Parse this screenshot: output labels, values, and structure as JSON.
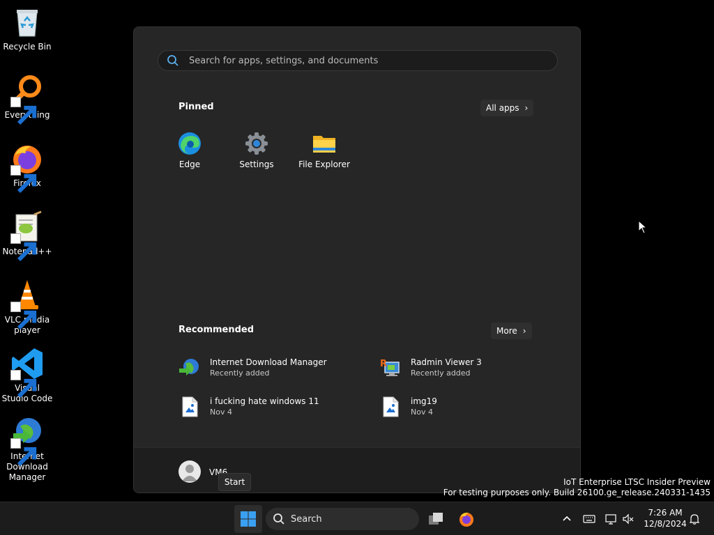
{
  "desktop": {
    "icons": [
      {
        "label": "Recycle Bin"
      },
      {
        "label": "Everything"
      },
      {
        "label": "Firefox"
      },
      {
        "label": "Notepad++"
      },
      {
        "label": "VLC media player"
      },
      {
        "label": "Visual Studio Code"
      },
      {
        "label": "Internet Download Manager"
      }
    ]
  },
  "start_menu": {
    "search_placeholder": "Search for apps, settings, and documents",
    "pinned_title": "Pinned",
    "all_apps_label": "All apps",
    "pinned": [
      {
        "label": "Edge",
        "icon": "edge-icon"
      },
      {
        "label": "Settings",
        "icon": "settings-gear-icon"
      },
      {
        "label": "File Explorer",
        "icon": "folder-icon"
      }
    ],
    "recommended_title": "Recommended",
    "more_label": "More",
    "recommended": [
      {
        "name": "Internet Download Manager",
        "sub": "Recently added",
        "icon": "idm-icon"
      },
      {
        "name": "Radmin Viewer 3",
        "sub": "Recently added",
        "icon": "radmin-icon"
      },
      {
        "name": "i fucking hate windows 11",
        "sub": "Nov 4",
        "icon": "image-file-icon"
      },
      {
        "name": "img19",
        "sub": "Nov 4",
        "icon": "image-file-icon"
      }
    ],
    "user_name": "VM6",
    "tooltip": "Start"
  },
  "watermark": {
    "line1": "IoT Enterprise LTSC Insider Preview",
    "line2": "For testing purposes only. Build 26100.ge_release.240331-1435"
  },
  "taskbar": {
    "search_label": "Search",
    "time": "7:26 AM",
    "date": "12/8/2024"
  },
  "colors": {
    "start_bg": "#262626",
    "taskbar_bg": "#1c1c1c",
    "accent": "#0078d4"
  }
}
